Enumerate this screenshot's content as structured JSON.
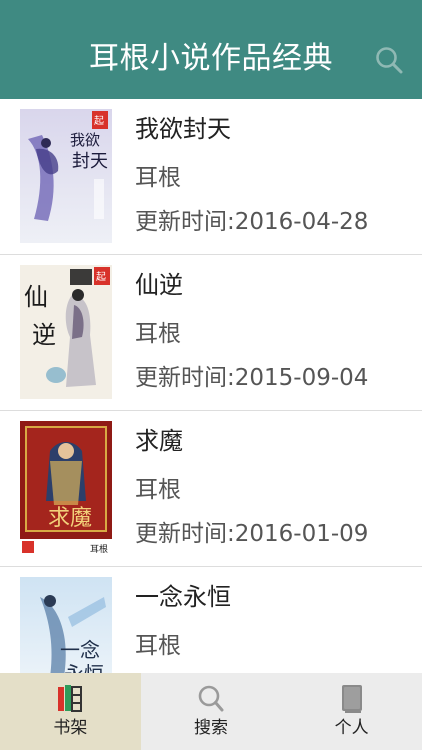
{
  "header": {
    "title": "耳根小说作品经典",
    "search_icon": "search-icon"
  },
  "books": [
    {
      "title": "我欲封天",
      "author": "耳根",
      "updated": "更新时间:2016-04-28",
      "cover_text": "我欲封天"
    },
    {
      "title": "仙逆",
      "author": "耳根",
      "updated": "更新时间:2015-09-04",
      "cover_text": "仙逆"
    },
    {
      "title": "求魔",
      "author": "耳根",
      "updated": "更新时间:2016-01-09",
      "cover_text": "求魔"
    },
    {
      "title": "一念永恒",
      "author": "耳根",
      "updated": "",
      "cover_text": "一念永恒"
    }
  ],
  "tabbar": {
    "tabs": [
      {
        "label": "书架",
        "icon": "bookshelf-icon",
        "active": true
      },
      {
        "label": "搜索",
        "icon": "search-icon",
        "active": false
      },
      {
        "label": "个人",
        "icon": "book-icon",
        "active": false
      }
    ]
  },
  "colors": {
    "header": "#3f8a82",
    "tab_active": "#e4dfc8",
    "tabbar": "#ececec"
  }
}
